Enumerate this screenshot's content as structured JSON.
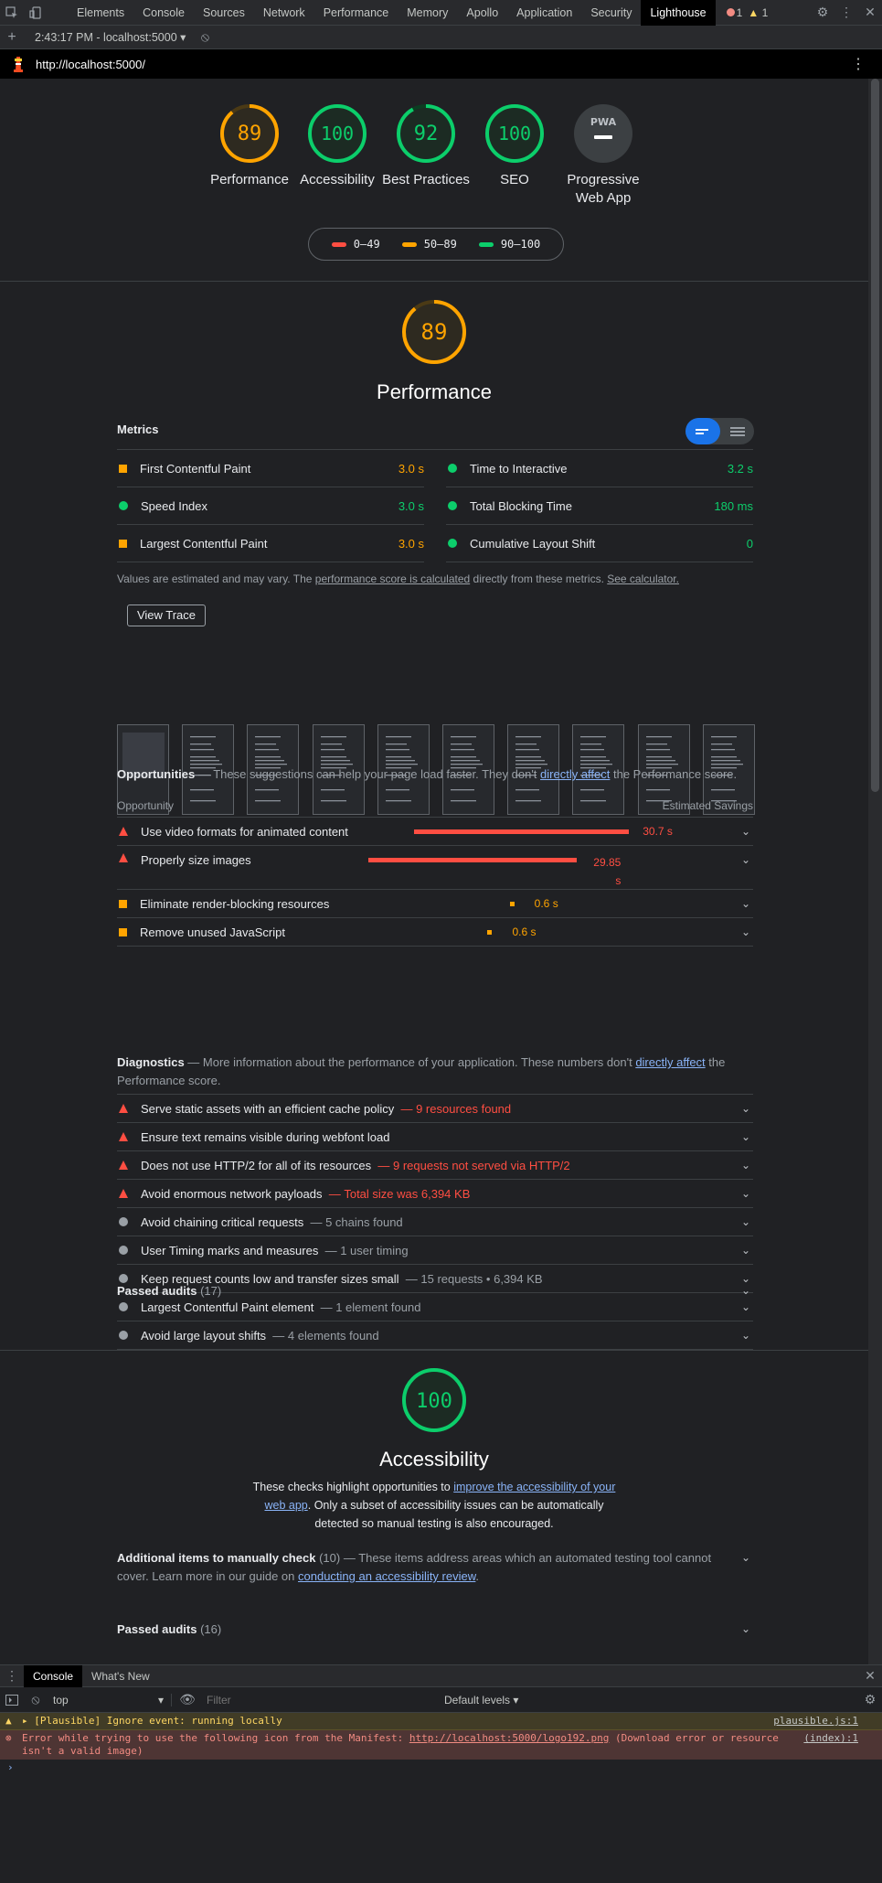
{
  "devtools": {
    "tabs": [
      "Elements",
      "Console",
      "Sources",
      "Network",
      "Performance",
      "Memory",
      "Apollo",
      "Application",
      "Security",
      "Lighthouse"
    ],
    "active_tab": "Lighthouse",
    "error_count": "1",
    "warning_count": "1",
    "report_selector": "2:43:17 PM - localhost:5000 ▾",
    "url": "http://localhost:5000/"
  },
  "scores": [
    {
      "label": "Performance",
      "value": "89",
      "color": "#ffa400",
      "fraction": 0.89
    },
    {
      "label": "Accessibility",
      "value": "100",
      "color": "#0cce6b",
      "fraction": 1.0
    },
    {
      "label": "Best Practices",
      "value": "92",
      "color": "#0cce6b",
      "fraction": 0.92
    },
    {
      "label": "SEO",
      "value": "100",
      "color": "#0cce6b",
      "fraction": 1.0
    },
    {
      "label": "Progressive Web App",
      "value": "PWA",
      "color": "#9aa0a6",
      "fraction": 0
    }
  ],
  "legend": [
    {
      "label": "0–49",
      "color": "#ff4e42"
    },
    {
      "label": "50–89",
      "color": "#ffa400"
    },
    {
      "label": "90–100",
      "color": "#0cce6b"
    }
  ],
  "performance": {
    "score": "89",
    "title": "Performance",
    "metrics_heading": "Metrics",
    "metrics": [
      {
        "label": "First Contentful Paint",
        "value": "3.0 s",
        "status": "average"
      },
      {
        "label": "Time to Interactive",
        "value": "3.2 s",
        "status": "pass"
      },
      {
        "label": "Speed Index",
        "value": "3.0 s",
        "status": "pass"
      },
      {
        "label": "Total Blocking Time",
        "value": "180 ms",
        "status": "pass"
      },
      {
        "label": "Largest Contentful Paint",
        "value": "3.0 s",
        "status": "average"
      },
      {
        "label": "Cumulative Layout Shift",
        "value": "0",
        "status": "pass"
      }
    ],
    "note_prefix": "Values are estimated and may vary. The ",
    "note_link1": "performance score is calculated",
    "note_mid": " directly from these metrics. ",
    "note_link2": "See calculator.",
    "view_trace": "View Trace",
    "opportunities_heading": "Opportunities",
    "opportunities_desc_pre": " — These suggestions can help your page load faster. They don't ",
    "opportunities_link": "directly affect",
    "opportunities_desc_post": " the Performance score.",
    "opp_col_left": "Opportunity",
    "opp_col_right": "Estimated Savings",
    "opportunities": [
      {
        "label": "Use video formats for animated content",
        "value": "30.7 s",
        "status": "fail",
        "savings_fraction": 1.0
      },
      {
        "label": "Properly size images",
        "value": "29.85 s",
        "status": "fail",
        "savings_fraction": 0.97
      },
      {
        "label": "Eliminate render-blocking resources",
        "value": "0.6 s",
        "status": "average",
        "savings_fraction": 0.02
      },
      {
        "label": "Remove unused JavaScript",
        "value": "0.6 s",
        "status": "average",
        "savings_fraction": 0.02
      }
    ],
    "diagnostics_heading": "Diagnostics",
    "diagnostics_desc_pre": " — More information about the performance of your application. These numbers don't ",
    "diagnostics_link": "directly affect",
    "diagnostics_desc_post": " the Performance score.",
    "diagnostics": [
      {
        "label": "Serve static assets with an efficient cache policy",
        "detail": "9 resources found",
        "status": "fail"
      },
      {
        "label": "Ensure text remains visible during webfont load",
        "detail": "",
        "status": "fail"
      },
      {
        "label": "Does not use HTTP/2 for all of its resources",
        "detail": "9 requests not served via HTTP/2",
        "status": "fail"
      },
      {
        "label": "Avoid enormous network payloads",
        "detail": "Total size was 6,394 KB",
        "status": "fail"
      },
      {
        "label": "Avoid chaining critical requests",
        "detail": "5 chains found",
        "status": "info"
      },
      {
        "label": "User Timing marks and measures",
        "detail": "1 user timing",
        "status": "info"
      },
      {
        "label": "Keep request counts low and transfer sizes small",
        "detail": "15 requests • 6,394 KB",
        "status": "info"
      },
      {
        "label": "Largest Contentful Paint element",
        "detail": "1 element found",
        "status": "info"
      },
      {
        "label": "Avoid large layout shifts",
        "detail": "4 elements found",
        "status": "info"
      }
    ],
    "passed_label": "Passed audits",
    "passed_count": "(17)"
  },
  "accessibility": {
    "score": "100",
    "title": "Accessibility",
    "desc_pre": "These checks highlight opportunities to ",
    "desc_link": "improve the accessibility of your web app",
    "desc_post": ". Only a subset of accessibility issues can be automatically detected so manual testing is also encouraged.",
    "manual_label": "Additional items to manually check",
    "manual_count": "(10)",
    "manual_desc": " — These items address areas which an automated testing tool cannot cover. Learn more in our guide on ",
    "manual_link": "conducting an accessibility review",
    "manual_end": ".",
    "passed_label": "Passed audits",
    "passed_count": "(16)"
  },
  "console": {
    "tabs": [
      "Console",
      "What's New"
    ],
    "context": "top",
    "filter_placeholder": "Filter",
    "levels": "Default levels ▾",
    "messages": [
      {
        "type": "warning",
        "text": "▸ [Plausible] Ignore event: running locally",
        "source": "plausible.js:1"
      },
      {
        "type": "error",
        "text": "Error while trying to use the following icon from the Manifest: ",
        "link": "http://localhost:5000/logo192.png",
        "text2": " (Download error or resource isn't a valid image)",
        "source": "(index):1"
      }
    ],
    "prompt": "›"
  }
}
